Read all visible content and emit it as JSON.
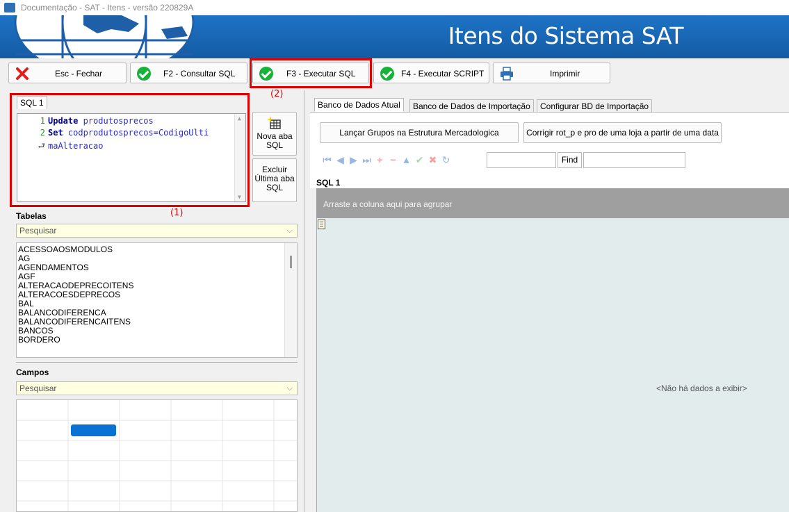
{
  "window": {
    "title": "Documentação - SAT - Itens - versão 220829A"
  },
  "banner": {
    "title": "Itens do Sistema SAT"
  },
  "toolbar": {
    "close": "Esc - Fechar",
    "consult_sql": "F2 - Consultar SQL",
    "execute_sql": "F3 - Executar SQL",
    "execute_script": "F4 - Executar SCRIPT",
    "print": "Imprimir"
  },
  "annotations": {
    "one": "(1)",
    "two": "(2)"
  },
  "sql_editor": {
    "tab": "SQL 1",
    "lines": [
      {
        "num": "1",
        "kw": "Update",
        "rest": " produtosprecos"
      },
      {
        "num": "2",
        "kw": "Set",
        "rest": " codprodutosprecos=CodigoUlti"
      },
      {
        "num": "",
        "kw": "",
        "rest": "maAlteracao"
      }
    ],
    "new_tab_button": [
      "Nova aba",
      "SQL"
    ],
    "delete_tab_button": [
      "Excluir",
      "Última aba",
      "SQL"
    ]
  },
  "tables": {
    "title": "Tabelas",
    "search_placeholder": "Pesquisar",
    "items": [
      "ACESSOAOSMODULOS",
      "AG",
      "AGENDAMENTOS",
      "AGF",
      "ALTERACAODEPRECOITENS",
      "ALTERACOESDEPRECOS",
      "BAL",
      "BALANCODIFERENCA",
      "BALANCODIFERENCAITENS",
      "BANCOS",
      "BORDERO"
    ]
  },
  "fields": {
    "title": "Campos",
    "search_placeholder": "Pesquisar"
  },
  "right_tabs": [
    "Banco de Dados Atual",
    "Banco de Dados de Importação",
    "Configurar BD de Importação"
  ],
  "actions": {
    "launch_groups": "Lançar Grupos na Estrutura Mercadologica",
    "fix_rot": "Corrigir rot_p e pro de uma loja a partir de uma data"
  },
  "navigator": {
    "find_label": "Find",
    "icons": [
      "first-icon",
      "prior-icon",
      "next-icon",
      "last-icon",
      "insert-icon",
      "delete-icon",
      "edit-icon",
      "post-icon",
      "cancel-icon",
      "refresh-icon"
    ]
  },
  "result": {
    "title": "SQL 1",
    "group_hint": "Arraste a coluna aqui para agrupar",
    "empty_text": "<Não há dados a exibir>"
  },
  "colors": {
    "banner": "#1e73c6",
    "highlight": "#e00000",
    "check": "#17b23a",
    "search_bg": "#ffffe1",
    "grid_bg": "#e2ecec"
  }
}
